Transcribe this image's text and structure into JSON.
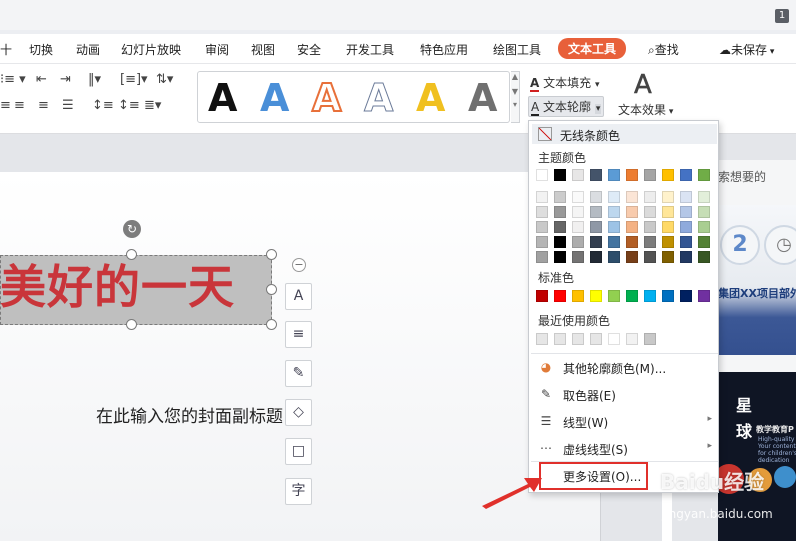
{
  "window": {
    "badge": "1"
  },
  "menu": {
    "items": [
      "十",
      "切换",
      "动画",
      "幻灯片放映",
      "审阅",
      "视图",
      "安全",
      "开发工具",
      "特色应用",
      "绘图工具",
      "文本工具",
      "查找",
      "未保存"
    ],
    "active": "文本工具"
  },
  "ribbon": {
    "left_icons": [
      "list-icon",
      "indent-icon",
      "align-icon"
    ],
    "text_fill": "文本填充",
    "text_outline": "文本轮廓",
    "text_effect": "文本效果",
    "style_letter": "A",
    "style_colors": [
      "#111111",
      "#4a8fd8",
      "#e8703a",
      "#7a8aa8",
      "#f0c020",
      "#6a6a6a"
    ]
  },
  "slide": {
    "title": "美好的一天",
    "subtitle": "在此输入您的封面副标题",
    "float_icons": [
      "A",
      "≡",
      "✎",
      "◇",
      "□",
      "字"
    ]
  },
  "right_panel": {
    "search_hint": "索想要的",
    "thumb1_digit": "2",
    "thumb1_band": "集团XX项目部外",
    "thumb2_char1": "星",
    "thumb2_char2": "球",
    "thumb2_text": "教学教育P",
    "thumb2_small": "High-quality PP\nYour content here\nfor children's\ndedication"
  },
  "dropdown": {
    "no_line": "无线条颜色",
    "theme_colors_label": "主题颜色",
    "standard_colors_label": "标准色",
    "recent_colors_label": "最近使用颜色",
    "theme_row": [
      "#ffffff",
      "#000000",
      "#e7e6e6",
      "#44546a",
      "#5b9bd5",
      "#ed7d31",
      "#a5a5a5",
      "#ffc000",
      "#4472c4",
      "#70ad47"
    ],
    "standard_row": [
      "#c00000",
      "#ff0000",
      "#ffc000",
      "#ffff00",
      "#92d050",
      "#00b050",
      "#00b0f0",
      "#0070c0",
      "#002060",
      "#7030a0"
    ],
    "recent_row": [
      "#e6e6e6",
      "#e6e6e6",
      "#e6e6e6",
      "#e6e6e6",
      "#ffffff",
      "#f2f2f2",
      "#c8c8c8"
    ],
    "items": [
      {
        "label": "其他轮廓颜色(M)...",
        "icon": "palette-icon",
        "arrow": ""
      },
      {
        "label": "取色器(E)",
        "icon": "eyedropper-icon",
        "arrow": ""
      },
      {
        "label": "线型(W)",
        "icon": "line-weight-icon",
        "arrow": "▸"
      },
      {
        "label": "虚线线型(S)",
        "icon": "dash-icon",
        "arrow": "▸"
      },
      {
        "label": "更多设置(O)...",
        "icon": "",
        "arrow": ""
      }
    ]
  },
  "watermark": {
    "brand": "Baidu经验",
    "url": "jingyan.baidu.com"
  }
}
